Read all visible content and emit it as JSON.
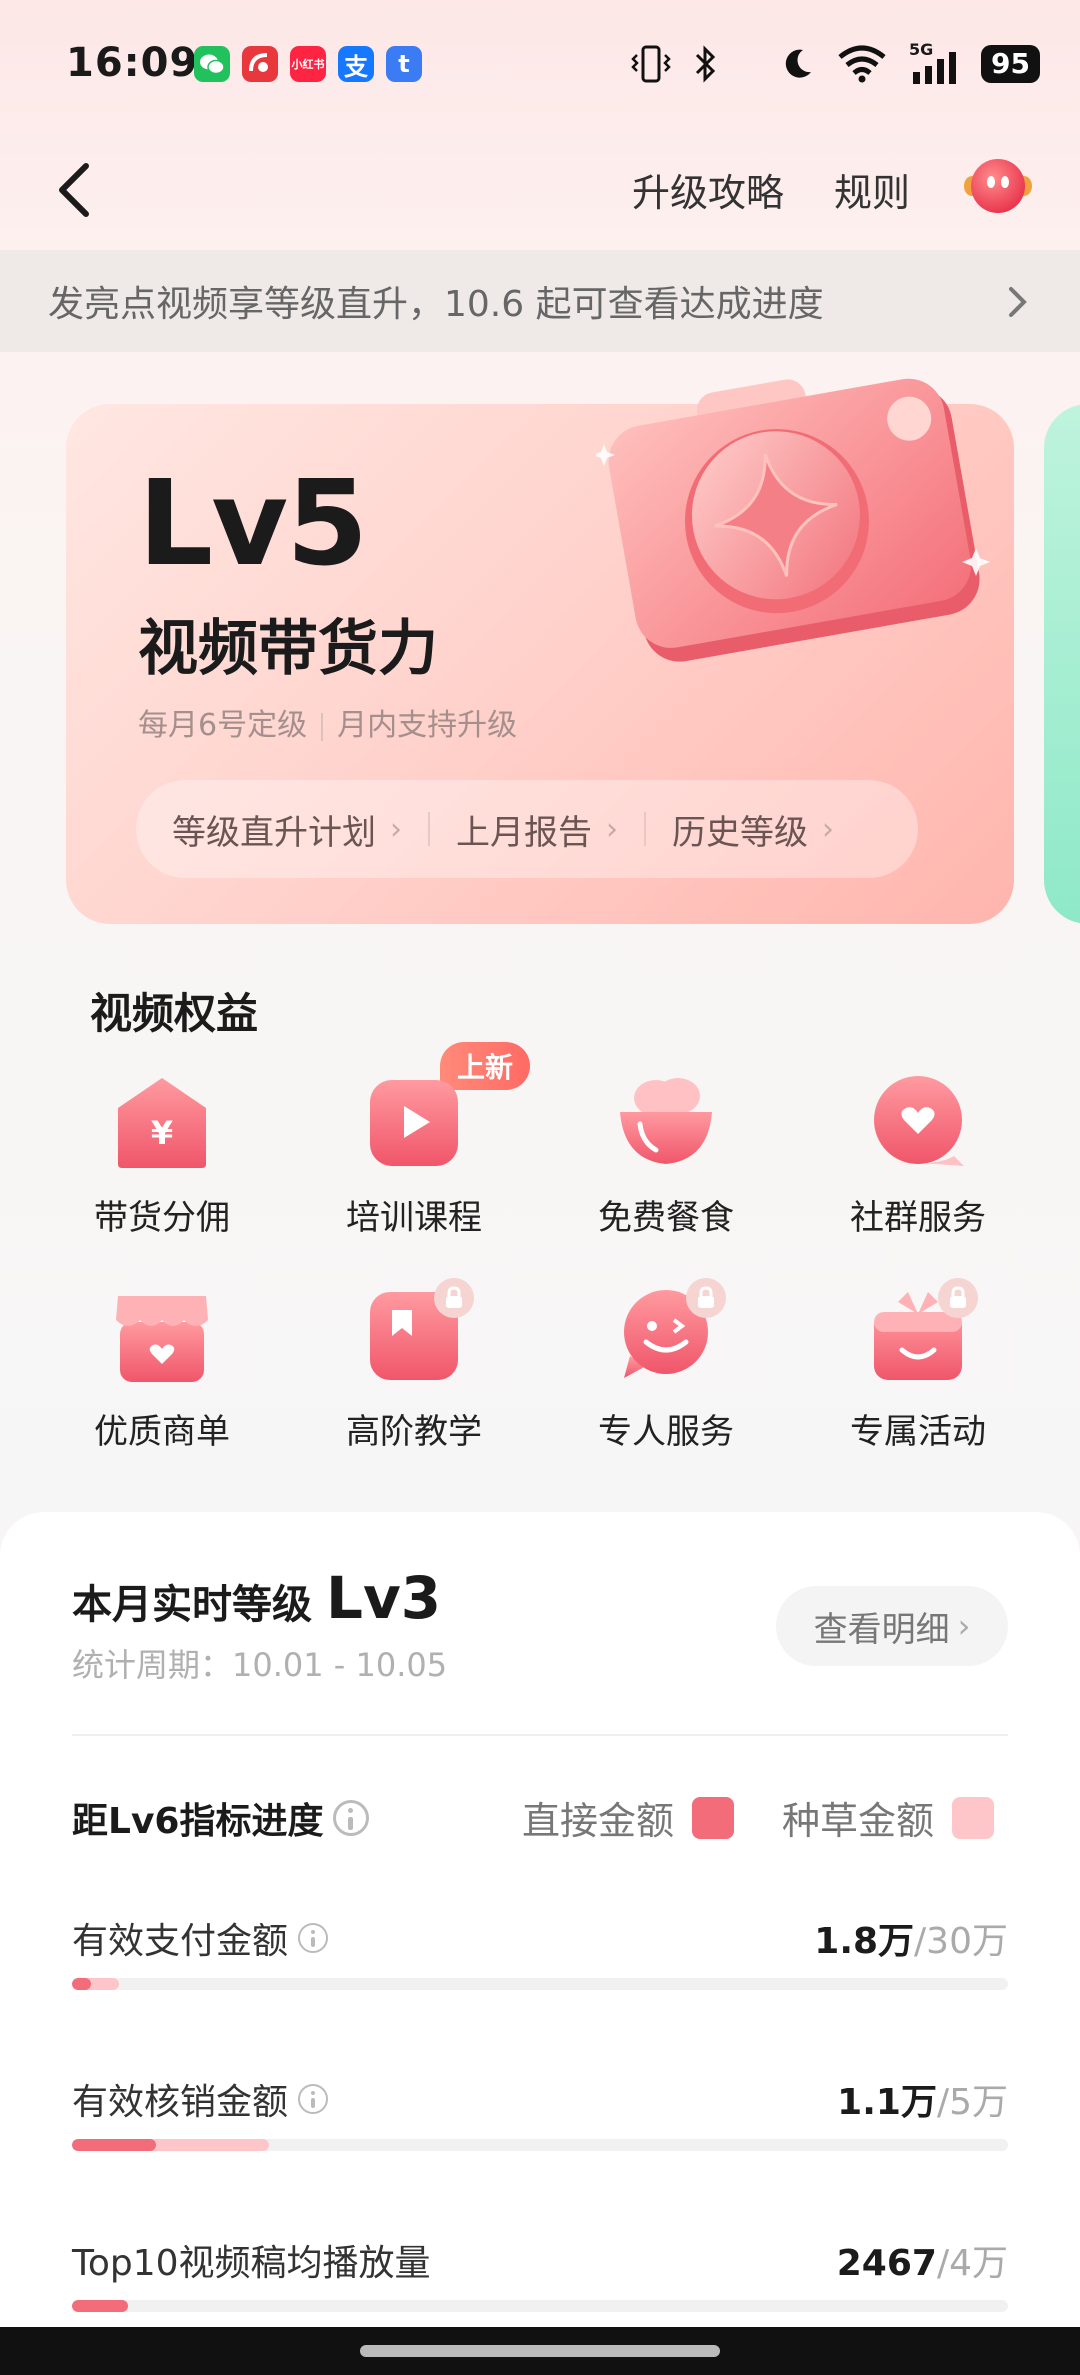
{
  "status_bar": {
    "time": "16:09",
    "battery": "95",
    "network": "5G",
    "apps": [
      {
        "name": "wechat-app-icon",
        "glyph": "●",
        "color": "#21c25e"
      },
      {
        "name": "app-red-icon",
        "glyph": "●",
        "color": "#e8383d"
      },
      {
        "name": "xiaohongshu-app-icon",
        "glyph": "小红书",
        "color": "#ff2442"
      },
      {
        "name": "alipay-app-icon",
        "glyph": "支",
        "color": "#1677ff"
      },
      {
        "name": "app-blue-icon",
        "glyph": "t",
        "color": "#3b7cf5"
      }
    ]
  },
  "nav": {
    "upgrade_guide": "升级攻略",
    "rules": "规则"
  },
  "notice": {
    "text": "发亮点视频享等级直升，10.6 起可查看达成进度"
  },
  "hero": {
    "level": "Lv5",
    "title": "视频带货力",
    "sub_left": "每月6号定级",
    "sub_right": "月内支持升级",
    "links": [
      "等级直升计划",
      "上月报告",
      "历史等级"
    ]
  },
  "benefits": {
    "title": "视频权益",
    "new_badge": "上新",
    "items": [
      {
        "label": "带货分佣",
        "icon": "commission-house-icon",
        "locked": false
      },
      {
        "label": "培训课程",
        "icon": "play-course-icon",
        "locked": false
      },
      {
        "label": "免费餐食",
        "icon": "meal-bowl-icon",
        "locked": false
      },
      {
        "label": "社群服务",
        "icon": "chat-heart-icon",
        "locked": false
      },
      {
        "label": "优质商单",
        "icon": "store-heart-icon",
        "locked": false
      },
      {
        "label": "高阶教学",
        "icon": "bookmark-book-icon",
        "locked": true
      },
      {
        "label": "专人服务",
        "icon": "smiley-chat-icon",
        "locked": true
      },
      {
        "label": "专属活动",
        "icon": "gift-box-icon",
        "locked": true
      }
    ]
  },
  "realtime": {
    "title": "本月实时等级",
    "level": "Lv3",
    "period": "统计周期：10.01 - 10.05",
    "detail_button": "查看明细"
  },
  "progress": {
    "title": "距Lv6指标进度",
    "legend": [
      {
        "label": "直接金额",
        "color": "#f36c7a"
      },
      {
        "label": "种草金额",
        "color": "#ffc6c9"
      }
    ],
    "metrics": [
      {
        "name": "有效支付金额",
        "current": "1.8万",
        "target": "/30万",
        "info": true,
        "direct": 0.02,
        "total": 0.05
      },
      {
        "name": "有效核销金额",
        "current": "1.1万",
        "target": "/5万",
        "info": true,
        "direct": 0.09,
        "total": 0.21
      },
      {
        "name": "Top10视频稿均播放量",
        "current": "2467",
        "target": "/4万",
        "info": false,
        "direct": 0.06,
        "total": 0.06
      }
    ]
  }
}
